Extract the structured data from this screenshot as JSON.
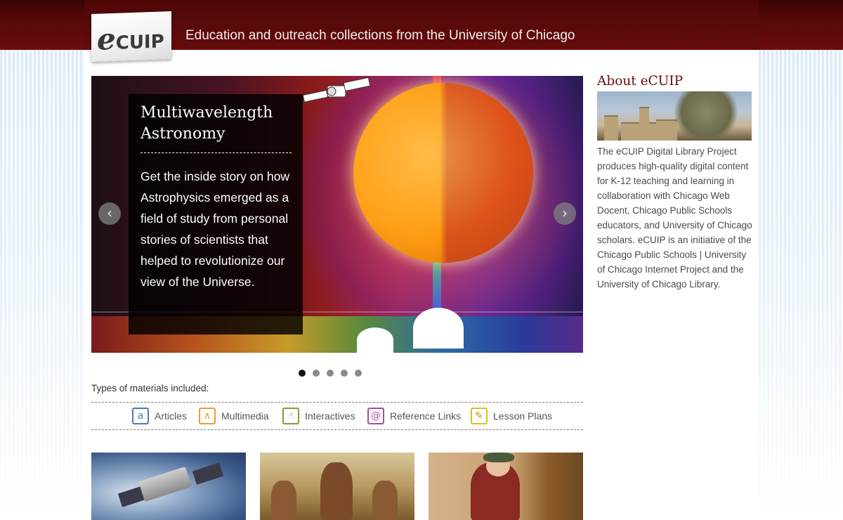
{
  "header": {
    "logo_text_e": "e",
    "logo_text_rest": "CUIP",
    "tagline": "Education and outreach collections from the University of Chicago"
  },
  "slider": {
    "slides_count": 5,
    "active_slide": 1,
    "caption_title": "Multiwavelength Astronomy",
    "caption_body": "Get the inside story on how Astrophysics emerged as a field of study from personal stories of scientists that helped to revolutionize our view of the Universe.",
    "prev_symbol": "‹",
    "next_symbol": "›"
  },
  "types": {
    "label": "Types of materials included:",
    "items": [
      {
        "label": "Articles",
        "icon": "articles-icon",
        "glyph": "a",
        "color": "#4a7ab0"
      },
      {
        "label": "Multimedia",
        "icon": "multimedia-icon",
        "glyph": "∧",
        "color": "#e0a030"
      },
      {
        "label": "Interactives",
        "icon": "interactives-icon",
        "glyph": "☝",
        "color": "#7aa030"
      },
      {
        "label": "Reference Links",
        "icon": "reference-links-icon",
        "glyph": "@",
        "color": "#a050a0"
      },
      {
        "label": "Lesson Plans",
        "icon": "lesson-plans-icon",
        "glyph": "✎",
        "color": "#d8c020"
      }
    ]
  },
  "sidebar": {
    "title": "About eCUIP",
    "text": "The eCUIP Digital Library Project produces high-quality digital content for K-12 teaching and learning in collaboration with Chicago Web Docent, Chicago Public Schools educators, and University of Chicago scholars. eCUIP is an initiative of the Chicago Public Schools | University of Chicago Internet Project and the University of Chicago Library."
  },
  "colors": {
    "header": "#5a0909",
    "sidebar_title": "#6a0c0c",
    "text": "#4a4a4a"
  }
}
